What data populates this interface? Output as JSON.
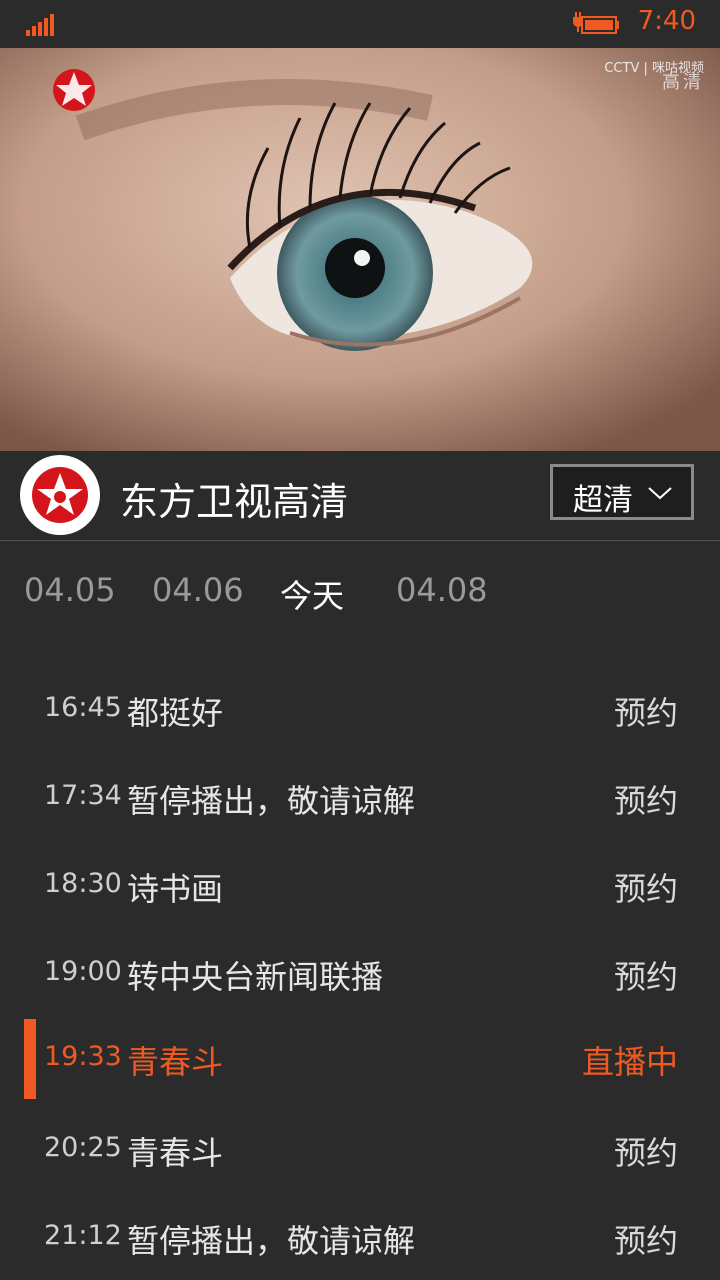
{
  "status": {
    "time": "7:40"
  },
  "video": {
    "overlay_brand": "CCTV | 咪咕视频",
    "overlay_hd": "高清"
  },
  "channel": {
    "name": "东方卫视高清",
    "quality": "超清"
  },
  "tabs": [
    "04.05",
    "04.06",
    "今天",
    "04.08"
  ],
  "active_tab": "今天",
  "programs": [
    {
      "time": "16:45",
      "title": "都挺好",
      "action": "预约",
      "live": false
    },
    {
      "time": "17:34",
      "title": "暂停播出，敬请谅解",
      "action": "预约",
      "live": false
    },
    {
      "time": "18:30",
      "title": "诗书画",
      "action": "预约",
      "live": false
    },
    {
      "time": "19:00",
      "title": "转中央台新闻联播",
      "action": "预约",
      "live": false
    },
    {
      "time": "19:33",
      "title": "青春斗",
      "action": "直播中",
      "live": true
    },
    {
      "time": "20:25",
      "title": "青春斗",
      "action": "预约",
      "live": false
    },
    {
      "time": "21:12",
      "title": "暂停播出，敬请谅解",
      "action": "预约",
      "live": false
    }
  ],
  "colors": {
    "accent": "#f05a22",
    "background": "#2b2b2b"
  },
  "icons": [
    "signal-icon",
    "battery-charging-icon",
    "chevron-down-icon",
    "dragon-tv-logo"
  ]
}
